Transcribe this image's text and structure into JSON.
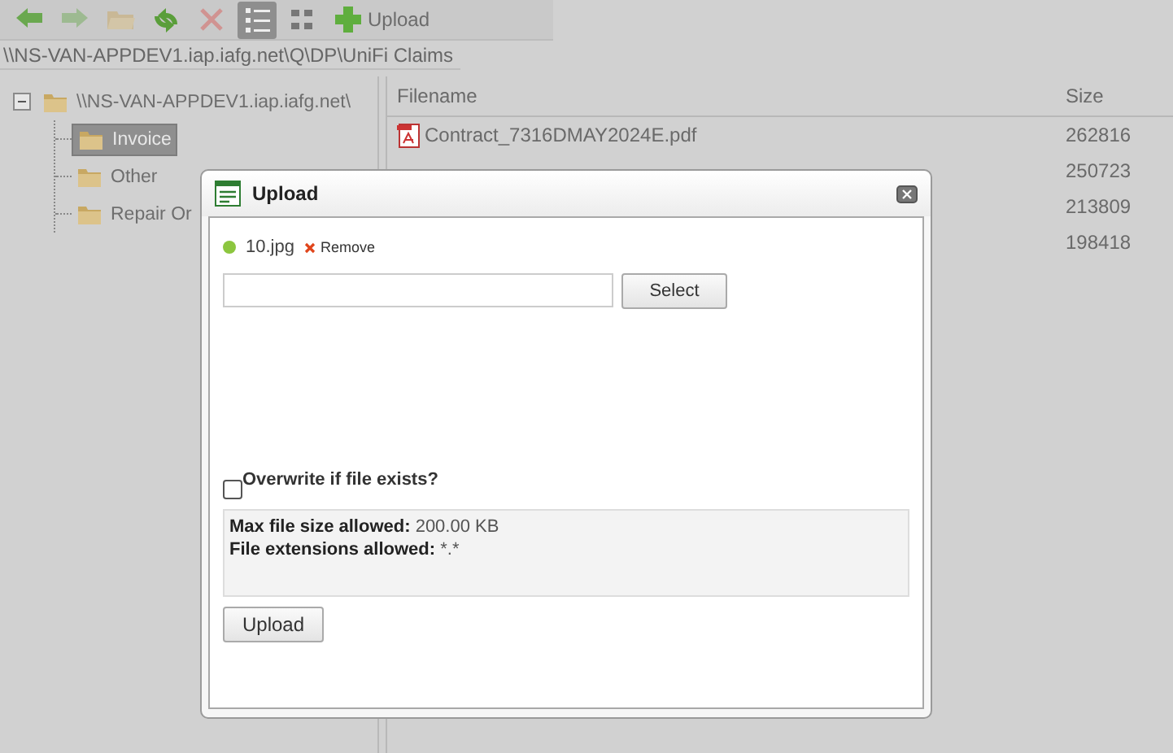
{
  "toolbar": [
    {
      "kind": "back",
      "disabled": false,
      "selected": false
    },
    {
      "kind": "forward",
      "disabled": true,
      "selected": false
    },
    {
      "kind": "open",
      "disabled": true,
      "selected": false
    },
    {
      "kind": "refresh",
      "disabled": false,
      "selected": false
    },
    {
      "kind": "delete",
      "disabled": true,
      "selected": false
    },
    {
      "kind": "list",
      "disabled": false,
      "selected": true
    },
    {
      "kind": "grid",
      "disabled": false,
      "selected": false
    },
    {
      "kind": "upload",
      "label": "Upload",
      "disabled": false,
      "selected": false
    }
  ],
  "path": "\\\\NS-VAN-APPDEV1.iap.iafg.net\\Q\\DP\\UniFi Claims",
  "tree": [
    {
      "label": "\\\\NS-VAN-APPDEV1.iap.iafg.net\\",
      "expanded": true,
      "selected": false,
      "children": [
        {
          "label": "Invoice",
          "selected": true
        },
        {
          "label": "Other",
          "selected": false
        },
        {
          "label": "Repair Or",
          "selected": false
        }
      ]
    }
  ],
  "files": {
    "columns": [
      "Filename",
      "Size"
    ],
    "rows": [
      {
        "name": "Contract_7316DMAY2024E.pdf",
        "size": "262816"
      },
      {
        "size": "250723"
      },
      {
        "size": "213809"
      },
      {
        "size": "198418"
      }
    ]
  },
  "dialog": {
    "title": "Upload",
    "uploads": [
      {
        "name": "10.jpg",
        "color": "#8cc63f",
        "action": "Remove"
      }
    ],
    "select_button": "Select",
    "overwrite": {
      "label": "Overwrite if file exists?",
      "checked": false
    },
    "info": [
      {
        "label": "Max file size allowed:",
        "value": "200.00 KB"
      },
      {
        "label": "File extensions allowed:",
        "value": "*.*"
      }
    ],
    "upload_button": "Upload"
  }
}
